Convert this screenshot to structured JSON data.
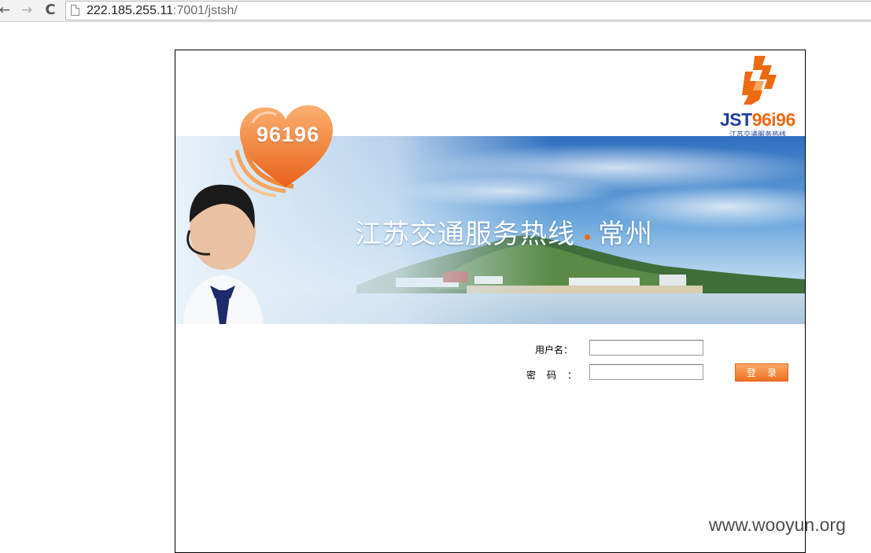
{
  "browser": {
    "back_icon": "←",
    "forward_icon": "→",
    "reload_icon": "C",
    "url_host": "222.185.255.11",
    "url_path": ":7001/jstsh/"
  },
  "logo": {
    "text_brand": "JST",
    "text_number": "96i96",
    "subtitle": "江苏交通服务热线",
    "mark_color": "#ee6a12"
  },
  "banner": {
    "heart_number": "96196",
    "title_main": "江苏交通服务热线",
    "title_city": "常州",
    "accent_color": "#ee6a12"
  },
  "login": {
    "username_label": "用户名：",
    "password_label": "密码",
    "password_colon": "：",
    "username_value": "",
    "password_value": "",
    "submit_label": "登录"
  },
  "watermark": "www.wooyun.org"
}
